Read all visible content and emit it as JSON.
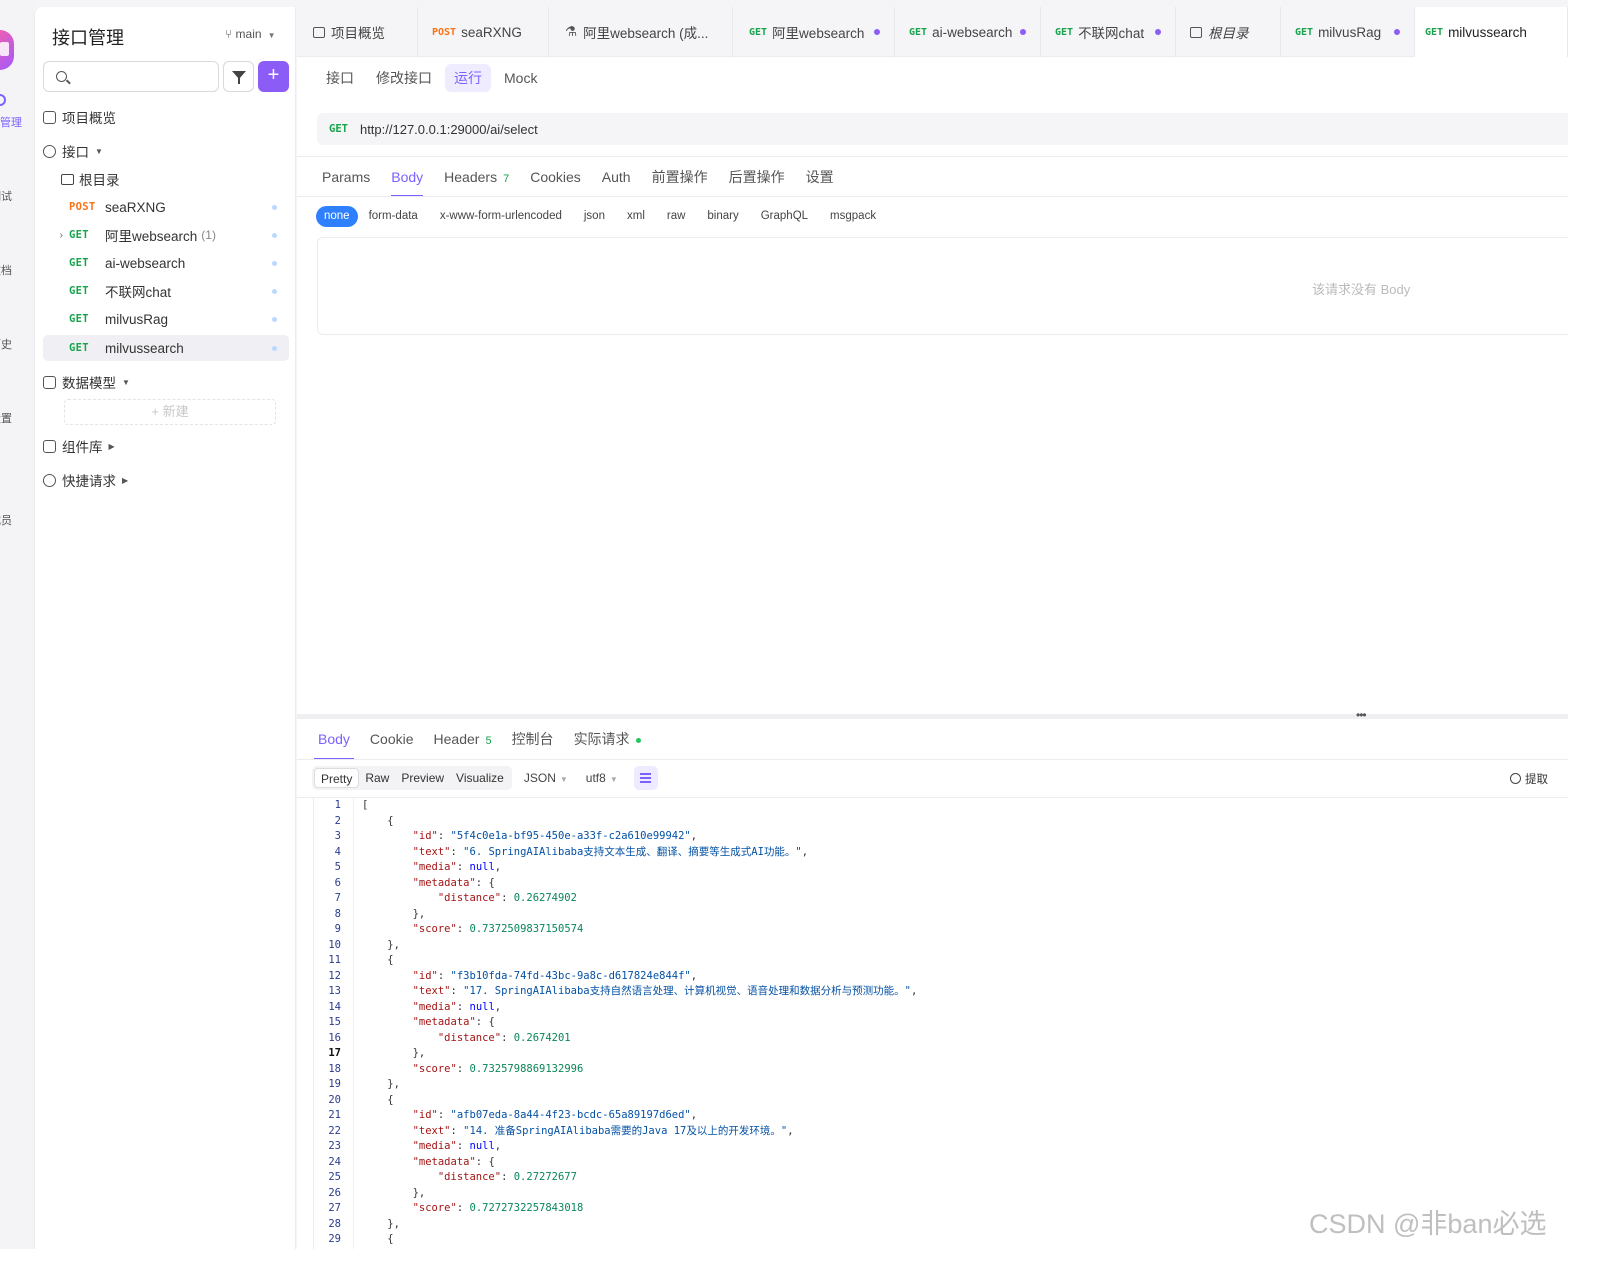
{
  "rail": {
    "items": [
      {
        "label": "管理",
        "active": true
      },
      {
        "label": "测试",
        "active": false
      },
      {
        "label": "文档",
        "active": false
      },
      {
        "label": "历史",
        "active": false
      },
      {
        "label": "设置",
        "active": false
      },
      {
        "label": "成员",
        "active": false
      }
    ]
  },
  "sidebar": {
    "title": "接口管理",
    "branch": "main",
    "search_placeholder": "",
    "add_label": "+",
    "overview": "项目概览",
    "apis": "接口",
    "root": "根目录",
    "tree": [
      {
        "method": "POST",
        "name": "seaRXNG",
        "count": ""
      },
      {
        "method": "GET",
        "name": "阿里websearch",
        "count": "(1)"
      },
      {
        "method": "GET",
        "name": "ai-websearch",
        "count": ""
      },
      {
        "method": "GET",
        "name": "不联网chat",
        "count": ""
      },
      {
        "method": "GET",
        "name": "milvusRag",
        "count": ""
      },
      {
        "method": "GET",
        "name": "milvussearch",
        "count": ""
      }
    ],
    "data_models": "数据模型",
    "new_label": "+ 新建",
    "components": "组件库",
    "quick_requests": "快捷请求"
  },
  "tabs": [
    {
      "method": "",
      "label": "项目概览",
      "dot": false,
      "italic": false
    },
    {
      "method": "POST",
      "label": "seaRXNG",
      "dot": false,
      "italic": false
    },
    {
      "method": "",
      "label": "阿里websearch (成...",
      "dot": false,
      "italic": false
    },
    {
      "method": "GET",
      "label": "阿里websearch",
      "dot": true,
      "italic": false
    },
    {
      "method": "GET",
      "label": "ai-websearch",
      "dot": true,
      "italic": false
    },
    {
      "method": "GET",
      "label": "不联网chat",
      "dot": true,
      "italic": false
    },
    {
      "method": "",
      "label": "根目录",
      "dot": false,
      "italic": true
    },
    {
      "method": "GET",
      "label": "milvusRag",
      "dot": true,
      "italic": false
    },
    {
      "method": "GET",
      "label": "milvussearch",
      "dot": false,
      "italic": false
    }
  ],
  "subtabs": [
    "接口",
    "修改接口",
    "运行",
    "Mock"
  ],
  "request": {
    "method": "GET",
    "url": "http://127.0.0.1:29000/ai/select"
  },
  "request_tabs": [
    {
      "label": "Params",
      "badge": ""
    },
    {
      "label": "Body",
      "badge": ""
    },
    {
      "label": "Headers",
      "badge": "7"
    },
    {
      "label": "Cookies",
      "badge": ""
    },
    {
      "label": "Auth",
      "badge": ""
    },
    {
      "label": "前置操作",
      "badge": ""
    },
    {
      "label": "后置操作",
      "badge": ""
    },
    {
      "label": "设置",
      "badge": ""
    }
  ],
  "body_types": [
    "none",
    "form-data",
    "x-www-form-urlencoded",
    "json",
    "xml",
    "raw",
    "binary",
    "GraphQL",
    "msgpack"
  ],
  "no_body_text": "该请求没有 Body",
  "splitter_handle": "•••",
  "response_tabs": [
    {
      "label": "Body",
      "badge": ""
    },
    {
      "label": "Cookie",
      "badge": ""
    },
    {
      "label": "Header",
      "badge": "5"
    },
    {
      "label": "控制台",
      "badge": ""
    },
    {
      "label": "实际请求",
      "badge": ""
    }
  ],
  "view_modes": [
    "Pretty",
    "Raw",
    "Preview",
    "Visualize"
  ],
  "format": "JSON",
  "encoding": "utf8",
  "extract_label": "提取",
  "code_lines": [
    [
      [
        "p",
        "["
      ]
    ],
    [
      [
        "p",
        "    {"
      ]
    ],
    [
      [
        "p",
        "        "
      ],
      [
        "k",
        "\"id\""
      ],
      [
        "p",
        ": "
      ],
      [
        "s",
        "\"5f4c0e1a-bf95-450e-a33f-c2a610e99942\""
      ],
      [
        "p",
        ","
      ]
    ],
    [
      [
        "p",
        "        "
      ],
      [
        "k",
        "\"text\""
      ],
      [
        "p",
        ": "
      ],
      [
        "s",
        "\"6. SpringAIAlibaba支持文本生成、翻译、摘要等生成式AI功能。\""
      ],
      [
        "p",
        ","
      ]
    ],
    [
      [
        "p",
        "        "
      ],
      [
        "k",
        "\"media\""
      ],
      [
        "p",
        ": "
      ],
      [
        "kw",
        "null"
      ],
      [
        "p",
        ","
      ]
    ],
    [
      [
        "p",
        "        "
      ],
      [
        "k",
        "\"metadata\""
      ],
      [
        "p",
        ": {"
      ]
    ],
    [
      [
        "p",
        "            "
      ],
      [
        "k",
        "\"distance\""
      ],
      [
        "p",
        ": "
      ],
      [
        "n",
        "0.26274902"
      ]
    ],
    [
      [
        "p",
        "        },"
      ]
    ],
    [
      [
        "p",
        "        "
      ],
      [
        "k",
        "\"score\""
      ],
      [
        "p",
        ": "
      ],
      [
        "n",
        "0.7372509837150574"
      ]
    ],
    [
      [
        "p",
        "    },"
      ]
    ],
    [
      [
        "p",
        "    {"
      ]
    ],
    [
      [
        "p",
        "        "
      ],
      [
        "k",
        "\"id\""
      ],
      [
        "p",
        ": "
      ],
      [
        "s",
        "\"f3b10fda-74fd-43bc-9a8c-d617824e844f\""
      ],
      [
        "p",
        ","
      ]
    ],
    [
      [
        "p",
        "        "
      ],
      [
        "k",
        "\"text\""
      ],
      [
        "p",
        ": "
      ],
      [
        "s",
        "\"17. SpringAIAlibaba支持自然语言处理、计算机视觉、语音处理和数据分析与预测功能。\""
      ],
      [
        "p",
        ","
      ]
    ],
    [
      [
        "p",
        "        "
      ],
      [
        "k",
        "\"media\""
      ],
      [
        "p",
        ": "
      ],
      [
        "kw",
        "null"
      ],
      [
        "p",
        ","
      ]
    ],
    [
      [
        "p",
        "        "
      ],
      [
        "k",
        "\"metadata\""
      ],
      [
        "p",
        ": {"
      ]
    ],
    [
      [
        "p",
        "            "
      ],
      [
        "k",
        "\"distance\""
      ],
      [
        "p",
        ": "
      ],
      [
        "n",
        "0.2674201"
      ]
    ],
    [
      [
        "p",
        "        },"
      ]
    ],
    [
      [
        "p",
        "        "
      ],
      [
        "k",
        "\"score\""
      ],
      [
        "p",
        ": "
      ],
      [
        "n",
        "0.7325798869132996"
      ]
    ],
    [
      [
        "p",
        "    },"
      ]
    ],
    [
      [
        "p",
        "    {"
      ]
    ],
    [
      [
        "p",
        "        "
      ],
      [
        "k",
        "\"id\""
      ],
      [
        "p",
        ": "
      ],
      [
        "s",
        "\"afb07eda-8a44-4f23-bcdc-65a89197d6ed\""
      ],
      [
        "p",
        ","
      ]
    ],
    [
      [
        "p",
        "        "
      ],
      [
        "k",
        "\"text\""
      ],
      [
        "p",
        ": "
      ],
      [
        "s",
        "\"14. 准备SpringAIAlibaba需要的Java 17及以上的开发环境。\""
      ],
      [
        "p",
        ","
      ]
    ],
    [
      [
        "p",
        "        "
      ],
      [
        "k",
        "\"media\""
      ],
      [
        "p",
        ": "
      ],
      [
        "kw",
        "null"
      ],
      [
        "p",
        ","
      ]
    ],
    [
      [
        "p",
        "        "
      ],
      [
        "k",
        "\"metadata\""
      ],
      [
        "p",
        ": {"
      ]
    ],
    [
      [
        "p",
        "            "
      ],
      [
        "k",
        "\"distance\""
      ],
      [
        "p",
        ": "
      ],
      [
        "n",
        "0.27272677"
      ]
    ],
    [
      [
        "p",
        "        },"
      ]
    ],
    [
      [
        "p",
        "        "
      ],
      [
        "k",
        "\"score\""
      ],
      [
        "p",
        ": "
      ],
      [
        "n",
        "0.7272732257843018"
      ]
    ],
    [
      [
        "p",
        "    },"
      ]
    ],
    [
      [
        "p",
        "    {"
      ]
    ]
  ],
  "current_line": 17,
  "watermark": "CSDN @非ban必选"
}
